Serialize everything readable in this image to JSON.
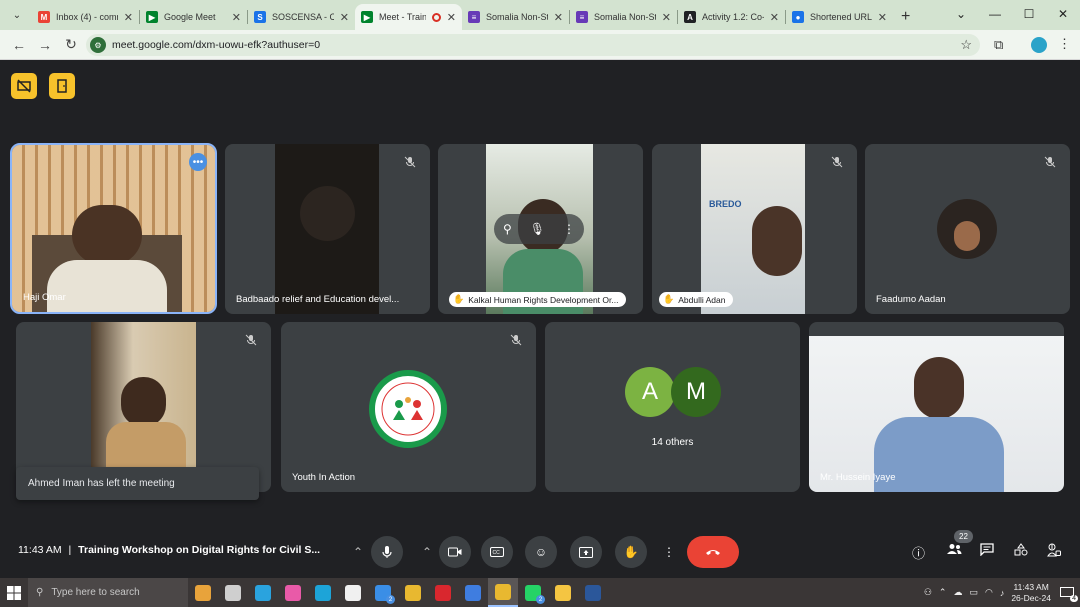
{
  "browser": {
    "tabs": [
      {
        "title": "Inbox (4) - comm",
        "favicon": "gmail-icon",
        "color": "#ea4335",
        "glyph": "M"
      },
      {
        "title": "Google Meet",
        "favicon": "meet-icon",
        "color": "#00832d",
        "glyph": "▶"
      },
      {
        "title": "SOSCENSA - Ca",
        "favicon": "soscensa-icon",
        "color": "#1a73e8",
        "glyph": "S"
      },
      {
        "title": "Meet - Traini",
        "favicon": "meet-icon",
        "color": "#00832d",
        "glyph": "▶",
        "active": true,
        "recording": true
      },
      {
        "title": "Somalia Non-Sta",
        "favicon": "forms-icon",
        "color": "#673ab7",
        "glyph": "≡"
      },
      {
        "title": "Somalia Non-Sta",
        "favicon": "forms-icon",
        "color": "#673ab7",
        "glyph": "≡"
      },
      {
        "title": "Activity 1.2: Co-",
        "favicon": "app-icon",
        "color": "#202124",
        "glyph": "A"
      },
      {
        "title": "Shortened URL",
        "favicon": "link-icon",
        "color": "#1a73e8",
        "glyph": "●"
      }
    ],
    "url": "meet.google.com/dxm-uowu-efk?authuser=0"
  },
  "participants": [
    {
      "name": "Haji Omar",
      "speaking": true
    },
    {
      "name": "Badbaado relief and Education devel...",
      "muted": true
    },
    {
      "name": "Kalkal Human Rights Development Or...",
      "pill": true
    },
    {
      "name": "Abdulli Adan",
      "pill": true,
      "muted": true
    },
    {
      "name": "Faadumo Aadan",
      "muted": true
    },
    {
      "name": "",
      "muted": true
    },
    {
      "name": "Youth In Action",
      "muted": true,
      "logo_text_top": "YOUTH IN ACTION SOMALIA",
      "logo_center": "YOUR WORLD",
      "logo_left": "YOUTH",
      "logo_right": "ACTION",
      "logo_bottom": "YOUR WAY"
    },
    {
      "name": "Mr. Hussein Iyaye"
    }
  ],
  "others": {
    "label": "14 others",
    "avatars": [
      {
        "initial": "A",
        "color": "#7cb342"
      },
      {
        "initial": "M",
        "color": "#33691e"
      }
    ]
  },
  "toast": "Ahmed Iman has left the meeting",
  "meeting": {
    "time": "11:43 AM",
    "separator": "|",
    "title": "Training Workshop on Digital Rights for Civil S...",
    "people_count": "22"
  },
  "taskbar": {
    "search_placeholder": "Type here to search",
    "time": "11:43 AM",
    "date": "26-Dec-24",
    "notif_count": "4",
    "apps": [
      {
        "name": "gift-icon",
        "color": "#e8a33b"
      },
      {
        "name": "task-view-icon",
        "color": "#cfcfcf"
      },
      {
        "name": "telegram-icon",
        "color": "#2aa3de"
      },
      {
        "name": "colorful-app-icon",
        "color": "#e95aa8"
      },
      {
        "name": "edge-icon",
        "color": "#1da4d8"
      },
      {
        "name": "store-icon",
        "color": "#f0f0f0"
      },
      {
        "name": "mail-icon",
        "color": "#3a8ee6",
        "count": "2"
      },
      {
        "name": "chrome-icon",
        "color": "#e8b830"
      },
      {
        "name": "mega-icon",
        "color": "#d9272e"
      },
      {
        "name": "calculator-icon",
        "color": "#3f7de0"
      },
      {
        "name": "chrome-active-icon",
        "color": "#e8b830",
        "active": true
      },
      {
        "name": "whatsapp-icon",
        "color": "#25d366",
        "count": "2"
      },
      {
        "name": "file-explorer-icon",
        "color": "#f4c542"
      },
      {
        "name": "word-icon",
        "color": "#2b579a"
      }
    ]
  }
}
